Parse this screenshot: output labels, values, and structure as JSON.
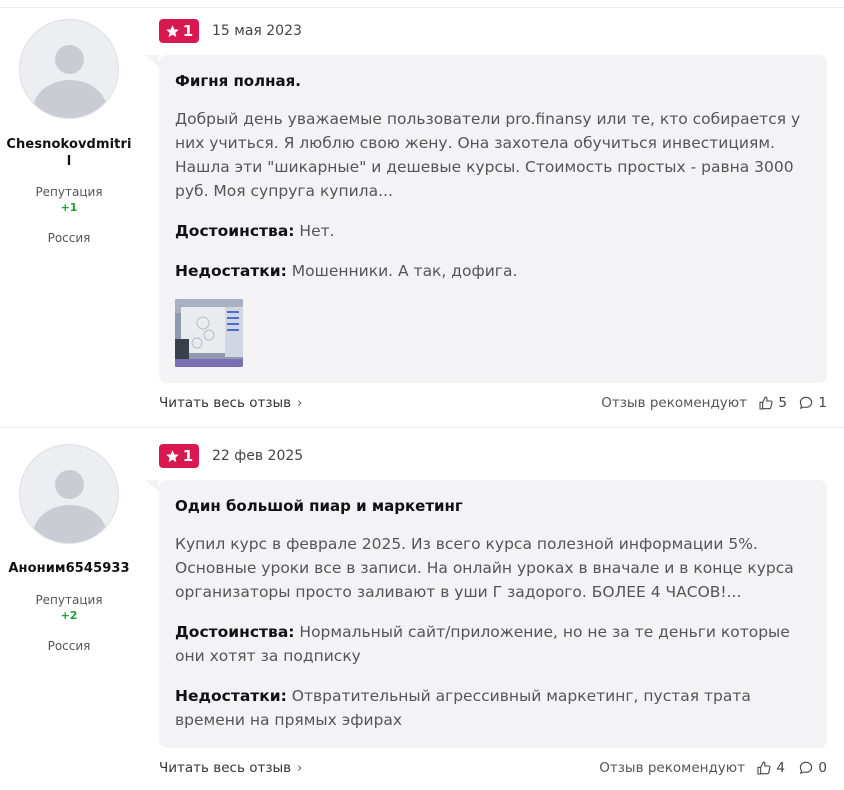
{
  "reviews": [
    {
      "author": {
        "name": "Chesnokovdmitril",
        "reputation_label": "Репутация",
        "reputation_value": "+1",
        "country": "Россия"
      },
      "rating": "1",
      "date": "15 мая 2023",
      "title": "Фигня полная.",
      "text": "Добрый день уважаемые пользователи pro.finansy или те, кто собирается у них учиться. Я люблю свою жену. Она захотела обучиться инвестициям. Нашла эти \"шикарные\" и дешевые курсы. Стоимость простых - равна 3000 руб. Моя супруга купила...",
      "pros_label": "Достоинства:",
      "pros": "Нет.",
      "cons_label": "Недостатки:",
      "cons": "Мошенники. А так, дофига.",
      "has_photo": true,
      "read_more": "Читать весь отзыв",
      "recommend_label": "Отзыв рекомендуют",
      "likes": "5",
      "comments": "1"
    },
    {
      "author": {
        "name": "Аноним6545933",
        "reputation_label": "Репутация",
        "reputation_value": "+2",
        "country": "Россия"
      },
      "rating": "1",
      "date": "22 фев 2025",
      "title": "Один большой пиар и маркетинг",
      "text": "Купил курс в феврале 2025. Из всего курса полезной информации 5%. Основные уроки все в записи. На онлайн уроках в вначале и в конце курса организаторы просто заливают в уши Г задорого. БОЛЕЕ 4 ЧАСОВ!...",
      "pros_label": "Достоинства:",
      "pros": "Нормальный сайт/приложение, но не за те деньги которые они хотят за подписку",
      "cons_label": "Недостатки:",
      "cons": "Отвратительный агрессивный маркетинг, пустая трата времени на прямых эфирах",
      "has_photo": false,
      "read_more": "Читать весь отзыв",
      "recommend_label": "Отзыв рекомендуют",
      "likes": "4",
      "comments": "0"
    }
  ],
  "colors": {
    "badge": "#d7194f",
    "reputation": "#1f9d3a",
    "card_bg": "#f3f3f6"
  },
  "icons": [
    "star-icon",
    "chevron-right-icon",
    "thumbs-up-icon",
    "comment-icon",
    "avatar-placeholder"
  ]
}
